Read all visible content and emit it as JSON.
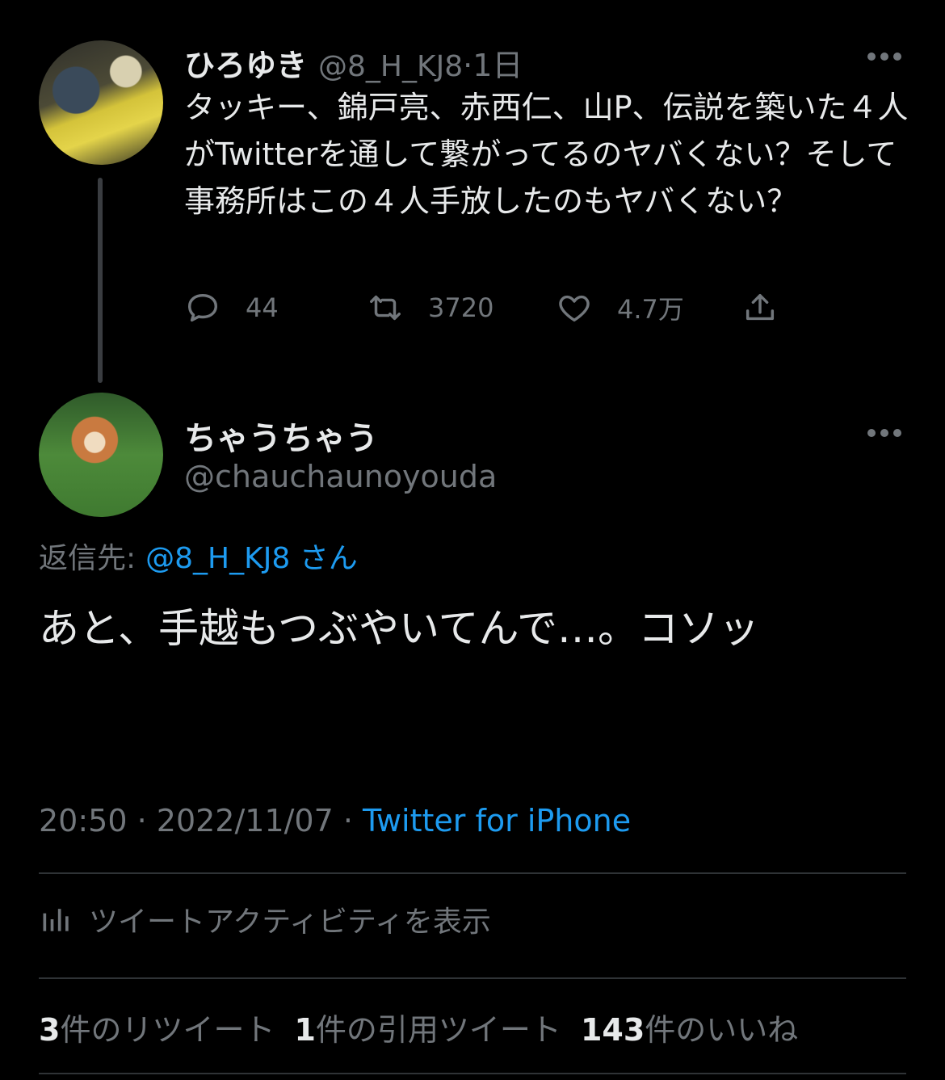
{
  "parent_tweet": {
    "display_name": "ひろゆき",
    "handle": "@8_H_KJ8",
    "separator": "·",
    "time_ago": "1日",
    "text": "タッキー、錦戸亮、赤西仁、山P、伝説を築いた４人がTwitterを通して繋がってるのヤバくない？そして事務所はこの４人手放したのもヤバくない？",
    "replies": "44",
    "retweets": "3720",
    "likes": "4.7万",
    "icons": [
      "reply-icon",
      "retweet-icon",
      "like-icon",
      "share-icon",
      "more-icon"
    ]
  },
  "main_tweet": {
    "display_name": "ちゃうちゃう",
    "handle": "@chauchaunoyouda",
    "reply_label": "返信先:",
    "reply_target": "@8_H_KJ8 さん",
    "text": "あと、手越もつぶやいてんで…。コソッ",
    "time": "20:50",
    "date": "2022/11/07",
    "source": "Twitter for iPhone",
    "activity_label": "ツイートアクティビティを表示",
    "stats": {
      "retweet_count": "3",
      "retweet_label": "件のリツイート",
      "quote_count": "1",
      "quote_label": "件の引用ツイート",
      "like_count": "143",
      "like_label": "件のいいね"
    }
  },
  "colors": {
    "background": "#000000",
    "text": "#e7e9ea",
    "muted": "#71767b",
    "link": "#1d9bf0",
    "divider": "#2f3336"
  }
}
